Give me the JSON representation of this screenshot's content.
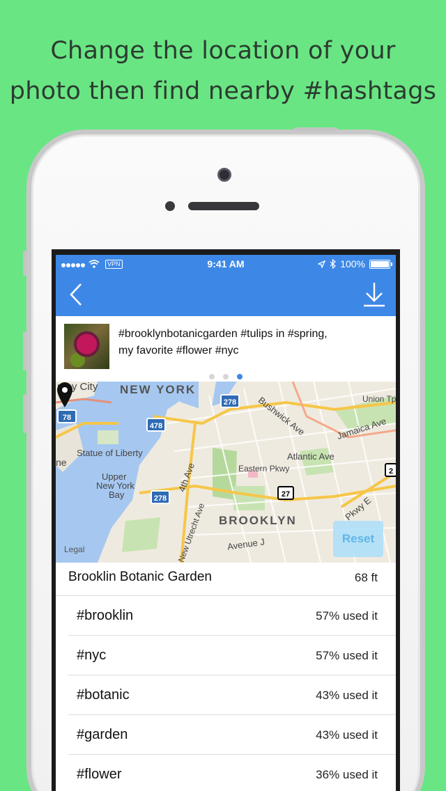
{
  "headline": {
    "line1": "Change the location of your",
    "line2": "photo then find nearby #hashtags"
  },
  "status_bar": {
    "vpn": "VPN",
    "time": "9:41 AM",
    "battery": "100%"
  },
  "nav": {
    "back_icon": "chevron-left-icon",
    "download_icon": "download-icon"
  },
  "post": {
    "caption_line1": "#brooklynbotanicgarden #tulips in #spring,",
    "caption_line2": "my favorite #flower #nyc",
    "page_count": 3,
    "active_page": 3
  },
  "map": {
    "labels": {
      "jersey_city": "rsey City",
      "new_york": "NEW YORK",
      "statue": "Statue of Liberty",
      "upper1": "Upper",
      "upper2": "New York",
      "upper3": "Bay",
      "brooklyn": "BROOKLYN",
      "bushwick": "Bushwick Ave",
      "atlantic": "Atlantic Ave",
      "eastern": "Eastern Pkwy",
      "jamaica": "Jamaica Ave",
      "union": "Union Tp",
      "fourth": "4th Ave",
      "new_utrecht": "New Utrecht Ave",
      "avenue_j": "Avenue J",
      "pkwy_e": "Pkwy E",
      "ne": "ne",
      "legal": "Legal"
    },
    "shields": {
      "s78": "78",
      "s478": "478",
      "s278a": "278",
      "s278b": "278",
      "s27": "27",
      "s2": "2"
    },
    "reset_label": "Reset"
  },
  "place": {
    "name": "Brooklin Botanic Garden",
    "distance": "68 ft"
  },
  "hashtags": [
    {
      "tag": "#brooklin",
      "usage": "57% used it"
    },
    {
      "tag": "#nyc",
      "usage": "57% used it"
    },
    {
      "tag": "#botanic",
      "usage": "43% used it"
    },
    {
      "tag": "#garden",
      "usage": "43% used it"
    },
    {
      "tag": "#flower",
      "usage": "36% used it"
    }
  ],
  "colors": {
    "background": "#69e683",
    "accent": "#3d88e6"
  }
}
